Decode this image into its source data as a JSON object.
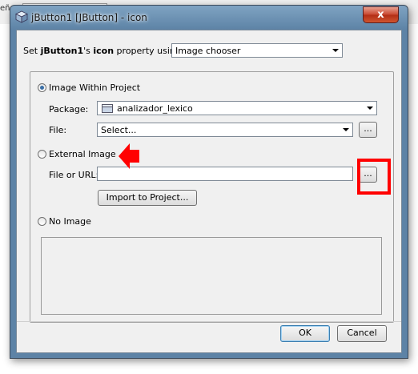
{
  "background": {
    "left_text": "eña",
    "field_text": "******************"
  },
  "window": {
    "title": "jButton1 [JButton] - icon",
    "close_label": "x"
  },
  "header": {
    "prefix": "Set ",
    "component": "jButton1",
    "middle": "'s ",
    "property": "icon",
    "suffix": " property using:",
    "chooser_value": "Image chooser"
  },
  "within_project": {
    "label": "Image Within Project",
    "selected": true,
    "package_label": "Package:",
    "package_value": "analizador_lexico",
    "file_label": "File:",
    "file_value": "Select...",
    "browse_label": "..."
  },
  "external": {
    "label": "External Image",
    "selected": false,
    "file_url_label": "File or URL:",
    "file_url_value": "",
    "browse_label": "...",
    "import_label": "Import to Project..."
  },
  "no_image": {
    "label": "No Image",
    "selected": false
  },
  "footer": {
    "ok_label": "OK",
    "cancel_label": "Cancel"
  },
  "colors": {
    "annotation_red": "#ff0000",
    "radio_selected": "#3a6ea5"
  }
}
